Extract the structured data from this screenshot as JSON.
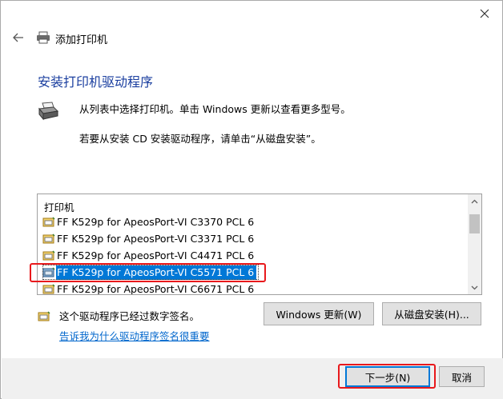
{
  "window": {
    "title": "添加打印机",
    "heading": "安装打印机驱动程序"
  },
  "description": {
    "line1": "从列表中选择打印机。单击 Windows 更新以查看更多型号。",
    "line2": "若要从安装 CD 安装驱动程序，请单击“从磁盘安装”。"
  },
  "list": {
    "header": "打印机",
    "items": [
      {
        "label": "FF K529p for ApeosPort-VI C3370 PCL 6"
      },
      {
        "label": "FF K529p for ApeosPort-VI C3371 PCL 6"
      },
      {
        "label": "FF K529p for ApeosPort-VI C4471 PCL 6"
      },
      {
        "label": "FF K529p for ApeosPort-VI C5571 PCL 6"
      },
      {
        "label": "FF K529p for ApeosPort-VI C6671 PCL 6"
      }
    ],
    "selected_index": 3
  },
  "signature": {
    "text": "这个驱动程序已经过数字签名。",
    "link": "告诉我为什么驱动程序签名很重要"
  },
  "buttons": {
    "windows_update": "Windows 更新(W)",
    "from_disk": "从磁盘安装(H)...",
    "next": "下一步(N)",
    "cancel": "取消"
  },
  "colors": {
    "heading": "#1a3e9f",
    "selection": "#0078d7",
    "highlight": "#e8191c",
    "link": "#0066cc"
  }
}
